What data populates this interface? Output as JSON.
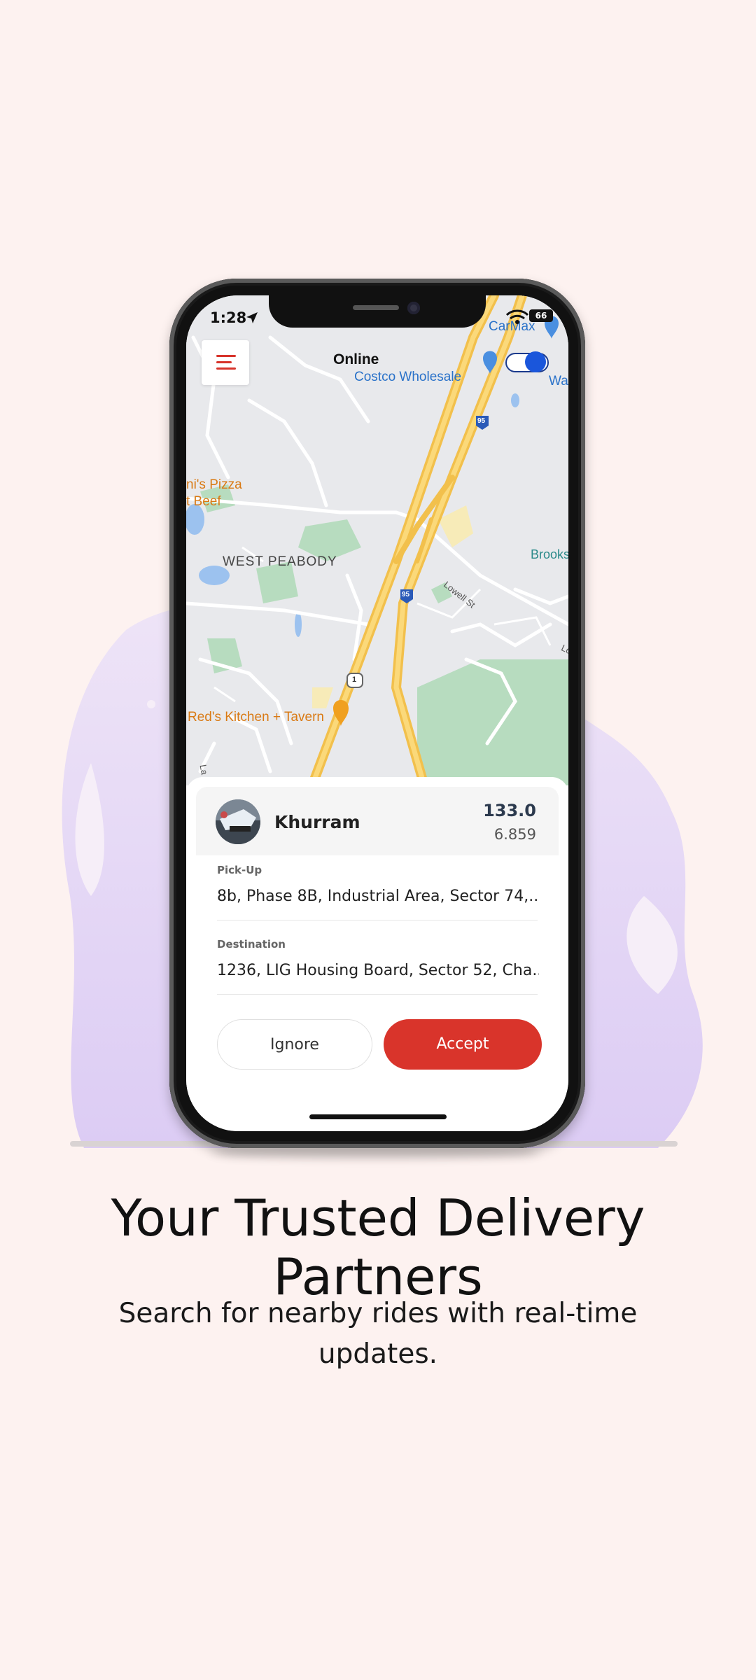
{
  "status_bar": {
    "time": "1:28",
    "battery": "66"
  },
  "header": {
    "online_label": "Online"
  },
  "map": {
    "labels": {
      "costco": "Costco Wholesale",
      "carmax": "CarMax",
      "walmart": "Wal",
      "pizza_line1": "ni's Pizza",
      "pizza_line2": "t Beef",
      "area": "WEST PEABODY",
      "brooks": "Brooks",
      "lowell": "Lowell St",
      "lo": "Lo",
      "reds": "Red's Kitchen + Tavern",
      "la": "La",
      "route_95": "95",
      "route_1": "1"
    }
  },
  "ride_request": {
    "driver_name": "Khurram",
    "amount": "133.0",
    "distance": "6.859",
    "pickup_label": "Pick-Up",
    "pickup_value": "8b, Phase 8B, Industrial Area, Sector 74,...",
    "destination_label": "Destination",
    "destination_value": "1236, LIG Housing Board, Sector 52, Cha...",
    "ignore_label": "Ignore",
    "accept_label": "Accept"
  },
  "onboarding": {
    "headline": "Your Trusted Delivery Partners",
    "subtext": "Search for nearby rides with real-time updates."
  },
  "colors": {
    "background": "#fdf2f0",
    "accent": "#d9342b",
    "toggle": "#1a56db",
    "blob": "#e0d3f5"
  }
}
